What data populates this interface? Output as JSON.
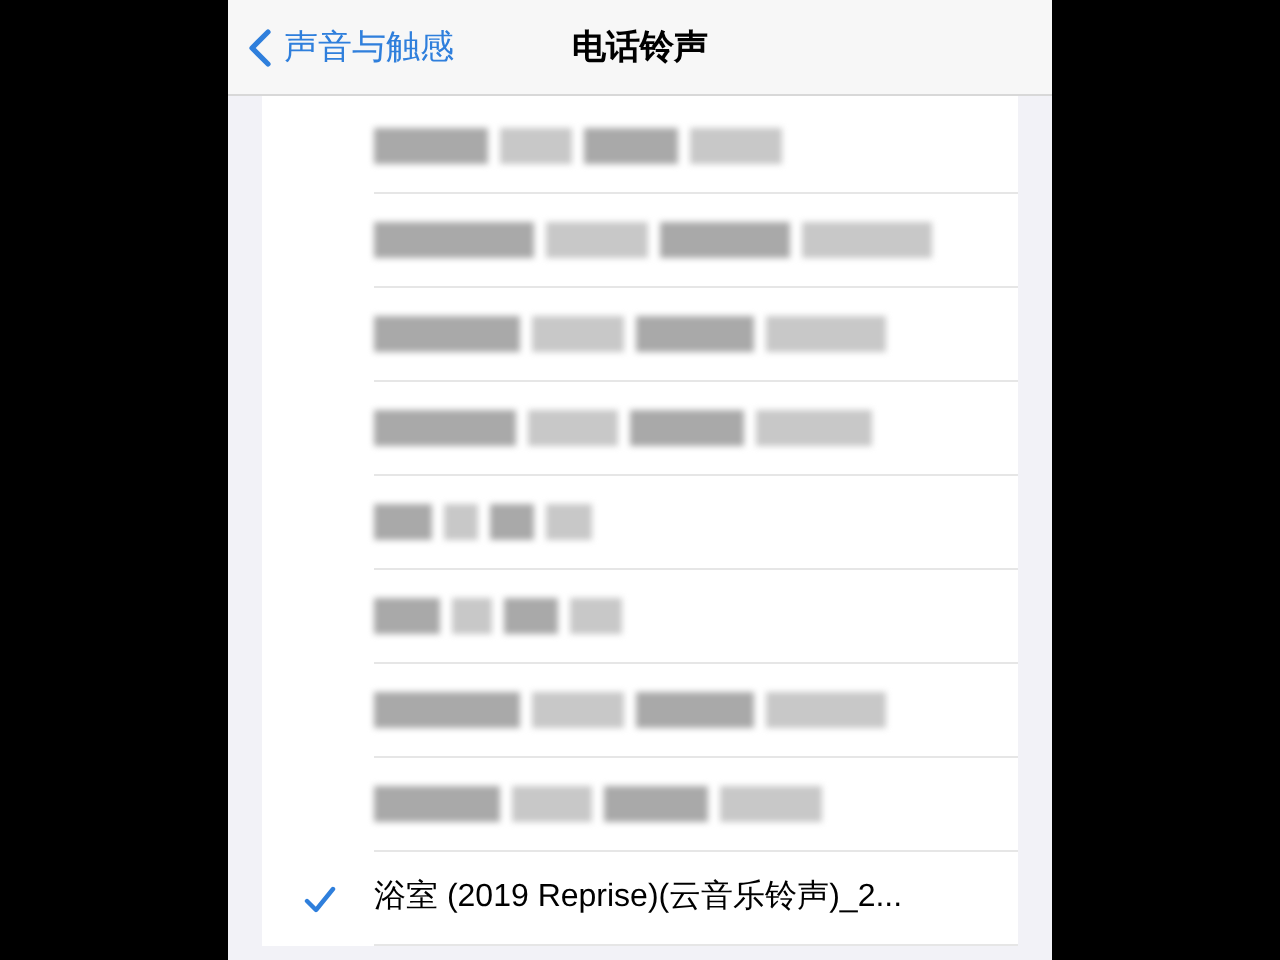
{
  "nav_bar": {
    "back_label": "声音与触感",
    "title": "电话铃声"
  },
  "ringtones": [
    {
      "kind": "redacted",
      "selected": false
    },
    {
      "kind": "redacted",
      "selected": false
    },
    {
      "kind": "redacted",
      "selected": false
    },
    {
      "kind": "redacted",
      "selected": false
    },
    {
      "kind": "redacted",
      "selected": false
    },
    {
      "kind": "redacted",
      "selected": false
    },
    {
      "kind": "redacted",
      "selected": false
    },
    {
      "kind": "redacted",
      "selected": false
    },
    {
      "kind": "text",
      "label": "浴室 (2019 Reprise)(云音乐铃声)_2...",
      "selected": true
    }
  ]
}
